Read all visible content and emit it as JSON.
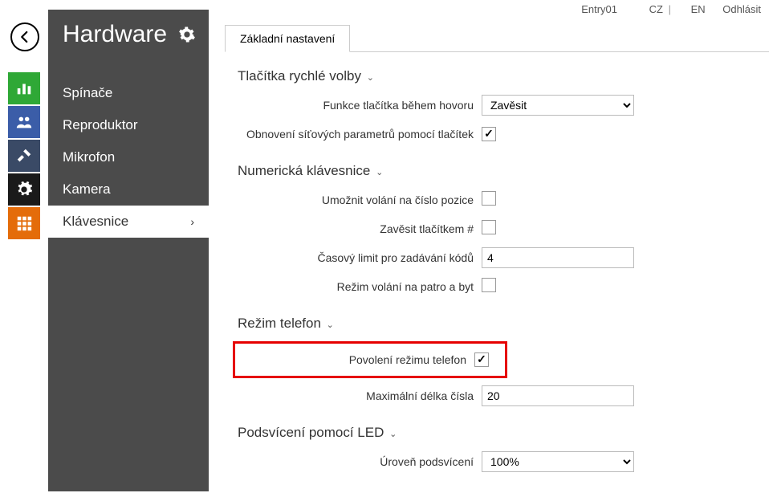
{
  "topbar": {
    "entry": "Entry01",
    "lang_cz": "CZ",
    "lang_en": "EN",
    "logout": "Odhlásit"
  },
  "sidebar": {
    "title": "Hardware",
    "items": [
      {
        "label": "Spínače"
      },
      {
        "label": "Reproduktor"
      },
      {
        "label": "Mikrofon"
      },
      {
        "label": "Kamera"
      },
      {
        "label": "Klávesnice"
      }
    ]
  },
  "tabs": {
    "basic": "Základní nastavení"
  },
  "sections": {
    "quickDial": {
      "title": "Tlačítka rychlé volby",
      "fnLabel": "Funkce tlačítka během hovoru",
      "fnValue": "Zavěsit",
      "resetLabel": "Obnovení síťových parametrů pomocí tlačítek",
      "resetChecked": true
    },
    "numeric": {
      "title": "Numerická klávesnice",
      "allowDialLabel": "Umožnit volání na číslo pozice",
      "allowDialChecked": false,
      "hangupHashLabel": "Zavěsit tlačítkem #",
      "hangupHashChecked": false,
      "codeTimeoutLabel": "Časový limit pro zadávání kódů",
      "codeTimeoutValue": "4",
      "floorAptLabel": "Režim volání na patro a byt",
      "floorAptChecked": false
    },
    "phone": {
      "title": "Režim telefon",
      "enableLabel": "Povolení režimu telefon",
      "enableChecked": true,
      "maxLenLabel": "Maximální délka čísla",
      "maxLenValue": "20"
    },
    "led": {
      "title": "Podsvícení pomocí LED",
      "levelLabel": "Úroveň podsvícení",
      "levelValue": "100%"
    }
  }
}
